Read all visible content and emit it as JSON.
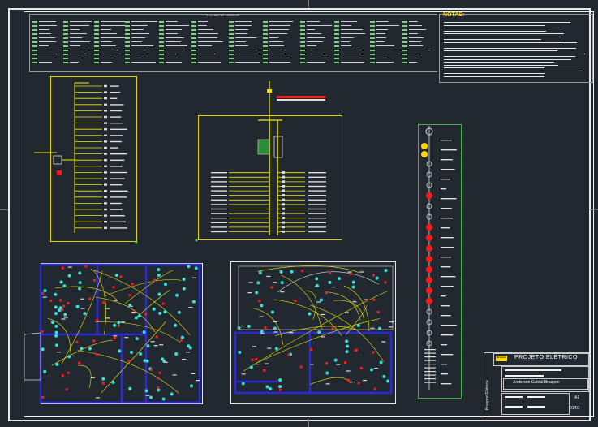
{
  "drawing": {
    "legend_title": "LEGENDA DE SÍMBOLOS",
    "notes_title": "NOTAS:",
    "title_block": {
      "project_title": "PROJETO ELÉTRICO",
      "author": "Anderson Cabral Braspon",
      "vertical_label": "Braspon Elétrica",
      "sheet_format": "A1",
      "sheet_number": "01/01",
      "logo_text": "Braspon"
    }
  },
  "colors": {
    "background": "#212830",
    "frame": "#e8e8e8",
    "panel_border": "#e6d200",
    "wiring": "#f2ea00",
    "circuit_symbol": "#ff1a1a",
    "fixture": "#35e0d6",
    "wall": "#2a2ad8",
    "legend_symbol": "#7fd37f"
  }
}
